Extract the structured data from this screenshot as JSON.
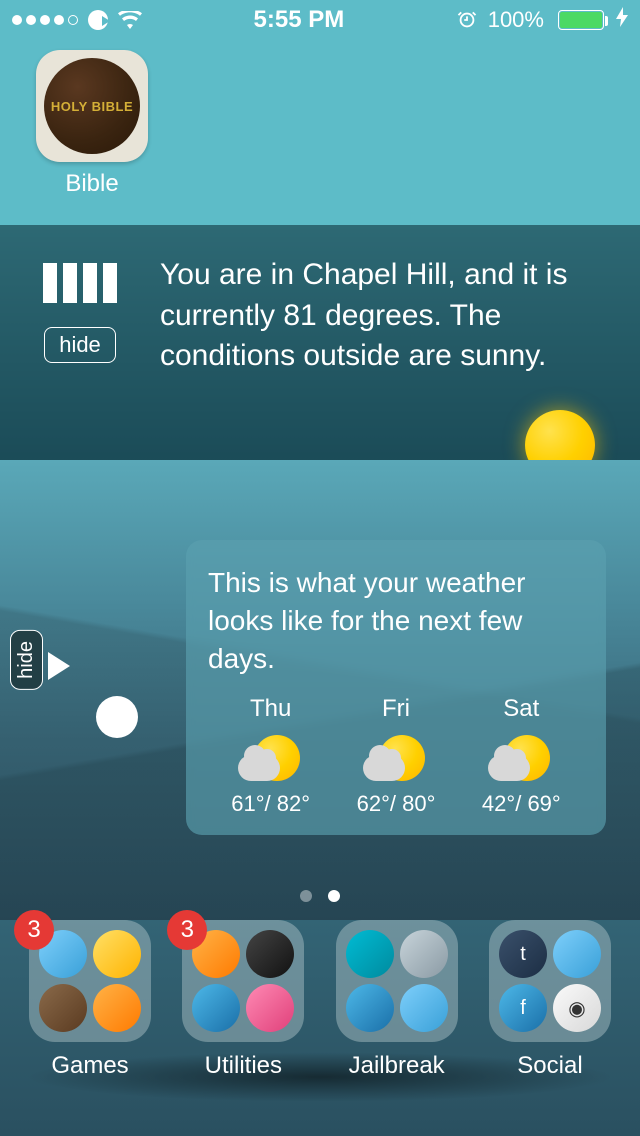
{
  "status": {
    "time": "5:55 PM",
    "battery_pct": "100%",
    "signal_dots": 5,
    "signal_filled": 4
  },
  "apps": {
    "top": {
      "label": "Bible",
      "icon_text": "HOLY BIBLE"
    }
  },
  "weather_current": {
    "hide_label": "hide",
    "text": "You are in Chapel Hill, and it is currently 81 degrees. The conditions outside are sunny."
  },
  "forecast": {
    "hide_label": "hide",
    "intro": "This is what your weather looks like for the next few days.",
    "days": [
      {
        "name": "Thu",
        "lo": "61°",
        "hi": "82°"
      },
      {
        "name": "Fri",
        "lo": "62°",
        "hi": "80°"
      },
      {
        "name": "Sat",
        "lo": "42°",
        "hi": "69°"
      }
    ]
  },
  "pager": {
    "count": 2,
    "active": 1
  },
  "dock": [
    {
      "label": "Games",
      "badge": "3"
    },
    {
      "label": "Utilities",
      "badge": "3"
    },
    {
      "label": "Jailbreak",
      "badge": null
    },
    {
      "label": "Social",
      "badge": null
    }
  ]
}
